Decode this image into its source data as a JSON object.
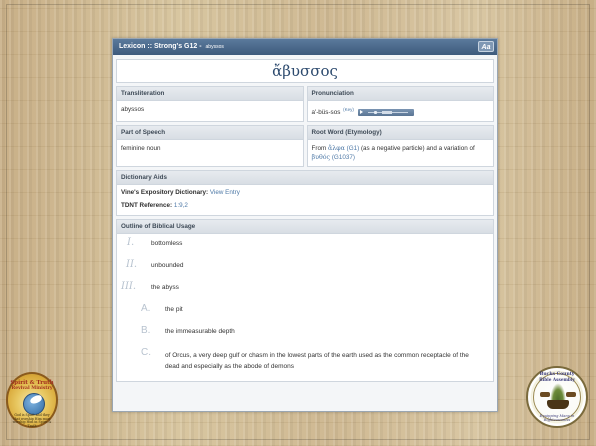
{
  "header": {
    "title": "Lexicon :: Strong's G12 - ",
    "subtitle": "abyssos",
    "font_button": "Aa"
  },
  "word": "ἄβυσσος",
  "transliteration": {
    "label": "Transliteration",
    "value": "abyssos"
  },
  "pronunciation": {
    "label": "Pronunciation",
    "value": "a'-büs-sos",
    "key": "(Key)"
  },
  "part_of_speech": {
    "label": "Part of Speech",
    "value": "feminine noun"
  },
  "root_word": {
    "label": "Root Word (Etymology)",
    "prefix": "From ",
    "greek1": "ἄλφα",
    "ref1": " (G1)",
    "middle": " (as a negative particle) and a variation of ",
    "greek2": "βυθός",
    "ref2": " (G1037)"
  },
  "dictionary_aids": {
    "label": "Dictionary Aids",
    "vine_label": "Vine's Expository Dictionary:",
    "vine_link": " View Entry",
    "tdnt_label": "TDNT Reference:",
    "tdnt_value": " 1:9,2"
  },
  "outline": {
    "label": "Outline of Biblical Usage",
    "items": [
      {
        "num": "I.",
        "text": "bottomless"
      },
      {
        "num": "II.",
        "text": "unbounded"
      },
      {
        "num": "III.",
        "text": "the abyss"
      },
      {
        "num": "A.",
        "text": "the pit"
      },
      {
        "num": "B.",
        "text": "the immeasurable depth"
      },
      {
        "num": "C.",
        "text": "of Orcus, a very deep gulf or chasm in the lowest parts of the earth used as the common receptacle of the dead and especially as the abode of demons"
      }
    ]
  },
  "logos": {
    "left_top": "Spirit & Truth",
    "left_top2": "Revival Ministry",
    "left_bottom": "God is Spirit and they that worship Him must worship Him in Spirit & Truth",
    "right_top": "Bucks County",
    "right_top2": "Bible Assembly",
    "right_bottom": "Equipping Many in Righteousness"
  }
}
